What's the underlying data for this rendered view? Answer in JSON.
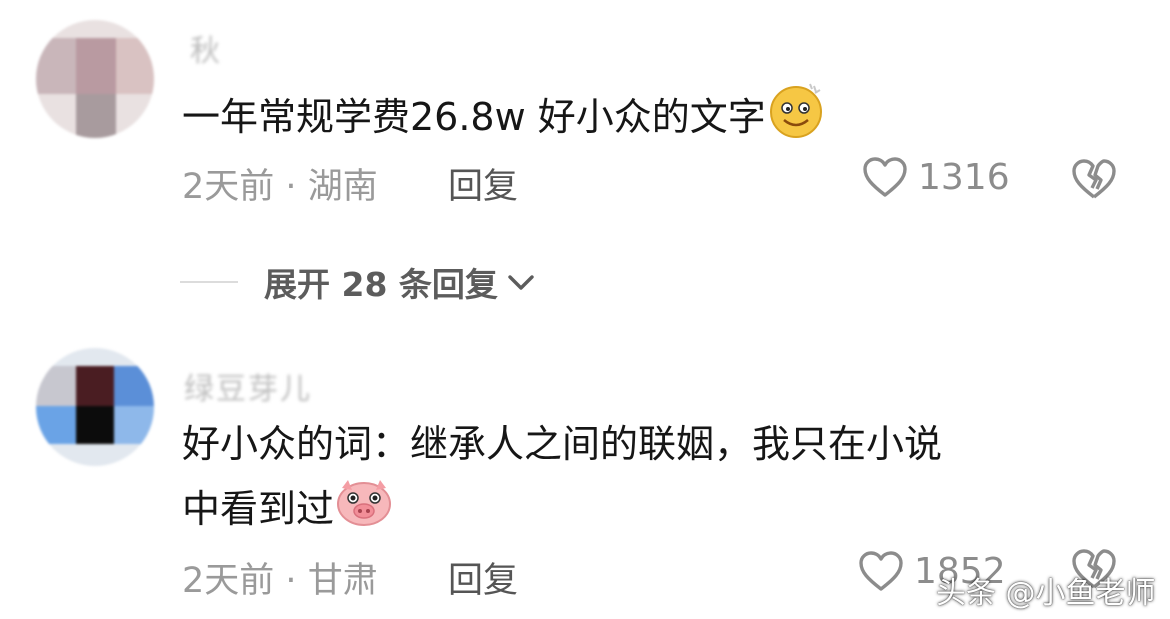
{
  "comments": [
    {
      "username": "秋",
      "text": "一年常规学费26.8w 好小众的文字",
      "emoji": "smile-emoji",
      "time": "2天前",
      "separator": "·",
      "location": "湖南",
      "reply_label": "回复",
      "likes": "1316"
    },
    {
      "username": "绿豆芽儿",
      "text_line1": "好小众的词：继承人之间的联姻，我只在小说",
      "text_line2": "中看到过",
      "emoji": "pig-emoji",
      "time": "2天前",
      "separator": "·",
      "location": "甘肃",
      "reply_label": "回复",
      "likes": "1852"
    }
  ],
  "expand_replies": "展开 28 条回复",
  "watermark": "头条 @小鱼老师",
  "colors": {
    "meta": "#9a9a9a",
    "reply": "#555555",
    "text": "#161616",
    "icon": "#8c8c8c"
  }
}
